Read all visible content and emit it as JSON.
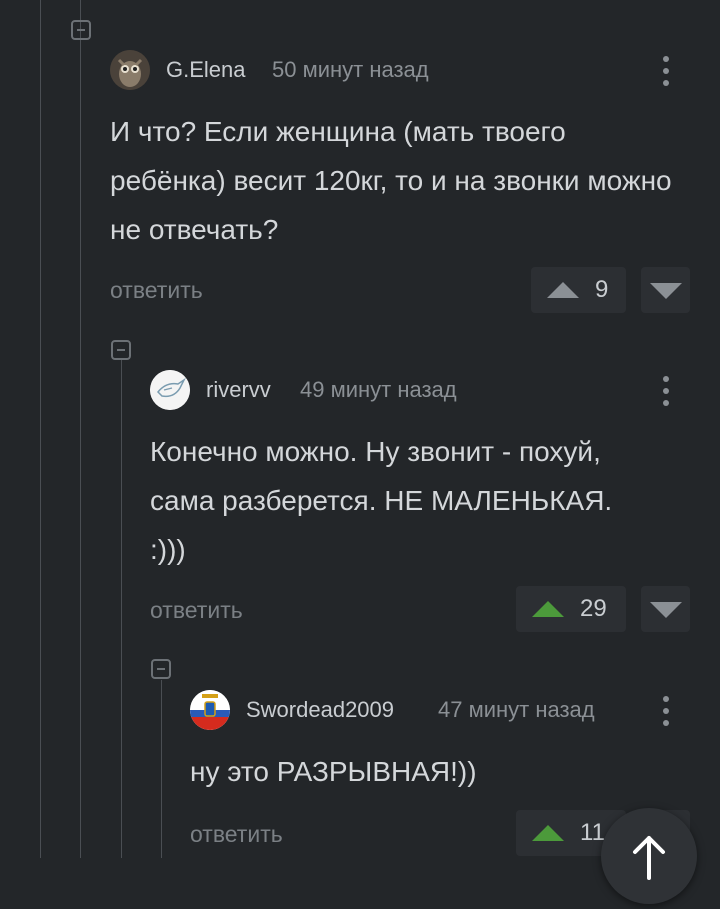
{
  "comments": [
    {
      "author": "G.Elena",
      "time": "50 минут назад",
      "text": "И что? Если женщина (мать твоего ребёнка) весит 120кг, то и на звонки можно не отвечать?",
      "reply_label": "ответить",
      "rating": "9",
      "upvote_color": "#8b9095"
    },
    {
      "author": "rivervv",
      "time": "49 минут назад",
      "text": "Конечно можно. Ну звонит - похуй, сама разберется. НЕ МАЛЕНЬКАЯ. :)))",
      "reply_label": "ответить",
      "rating": "29",
      "upvote_color": "#4c9a3b"
    },
    {
      "author": "Swordead2009",
      "time": "47 минут назад",
      "text": "ну это РАЗРЫВНАЯ!))",
      "reply_label": "ответить",
      "rating": "11",
      "upvote_color": "#4c9a3b"
    }
  ],
  "icons": {
    "collapse": "minus-square-icon",
    "more": "more-vertical-icon",
    "upvote": "arrow-up-icon",
    "downvote": "arrow-down-icon",
    "scroll_top": "arrow-up-icon"
  }
}
